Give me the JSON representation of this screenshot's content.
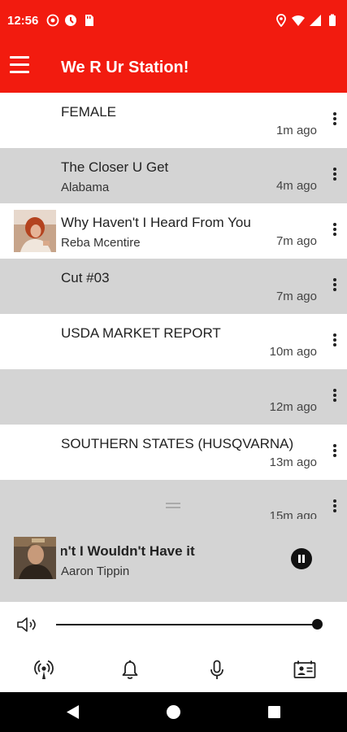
{
  "status_bar": {
    "time": "12:56"
  },
  "app_bar": {
    "title": "We R Ur Station!"
  },
  "feed": {
    "items": [
      {
        "title": "FEMALE",
        "artist": "",
        "time": "1m ago"
      },
      {
        "title": "The Closer U Get",
        "artist": "Alabama",
        "time": "4m ago"
      },
      {
        "title": "Why Haven't I Heard From You",
        "artist": "Reba Mcentire",
        "time": "7m ago"
      },
      {
        "title": "Cut #03",
        "artist": "",
        "time": "7m ago"
      },
      {
        "title": "USDA MARKET REPORT",
        "artist": "",
        "time": "10m ago"
      },
      {
        "title": "",
        "artist": "",
        "time": "12m ago"
      },
      {
        "title": "SOUTHERN STATES (HUSQVARNA)",
        "artist": "",
        "time": "13m ago"
      },
      {
        "title": "",
        "artist": "",
        "time": "15m ago"
      }
    ]
  },
  "now_playing": {
    "title": "Why Haven't I Wouldn't Have it",
    "title_visible": "ay I Wouldn't Have it",
    "artist": "Aaron Tippin"
  },
  "volume": {
    "level": 1.0
  },
  "bottom_nav": {
    "items": [
      {
        "icon": "podcast-icon"
      },
      {
        "icon": "bell-icon"
      },
      {
        "icon": "microphone-icon"
      },
      {
        "icon": "contact-card-icon"
      }
    ]
  },
  "colors": {
    "accent": "#f21b0f",
    "row_alt": "#d4d4d4"
  }
}
